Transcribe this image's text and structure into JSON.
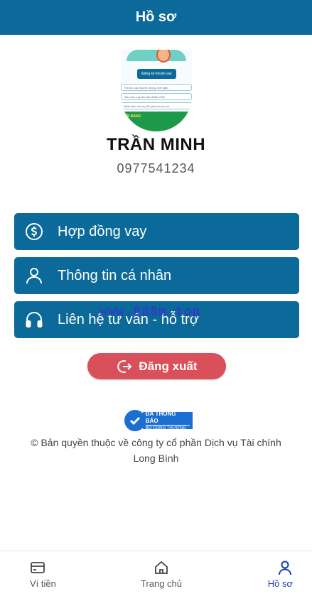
{
  "header": {
    "title": "Hồ sơ"
  },
  "avatar": {
    "mini_button": "Đăng ký khoản vay",
    "rows": [
      "Thủ tục vay nhanh chóng, đơn giản",
      "Hạn mức vay lên đến 500tr VND",
      "Nhận tiền chỉ sau 30 phút làm hồ sơ"
    ],
    "banner_tag": "IỂN BẰNG"
  },
  "profile": {
    "name": "TRẦN MINH",
    "phone": "0977541234"
  },
  "menu": {
    "items": [
      {
        "label": "Hợp đồng vay",
        "icon": "dollar-circle-icon"
      },
      {
        "label": "Thông tin cá nhân",
        "icon": "user-icon"
      },
      {
        "label": "Liên hệ tư vấn - hỗ trợ",
        "icon": "headphones-icon"
      }
    ]
  },
  "watermark": "www.888m.top",
  "logout": {
    "label": "Đăng xuất",
    "icon": "logout-icon"
  },
  "badge": {
    "line1": "ĐÃ THÔNG BÁO",
    "line2": "BỘ CÔNG THƯƠNG"
  },
  "footer": {
    "copyright": "© Bản quyền thuộc về công ty cổ phần Dịch vụ Tài chính Long Bình"
  },
  "bottom_nav": {
    "items": [
      {
        "label": "Ví tiền",
        "icon": "wallet-icon",
        "active": false
      },
      {
        "label": "Trang chủ",
        "icon": "home-icon",
        "active": false
      },
      {
        "label": "Hồ sơ",
        "icon": "user-icon",
        "active": true
      }
    ]
  },
  "colors": {
    "primary": "#0b6a99",
    "logout": "#d9505a",
    "nav_active": "#1d3fa8",
    "badge": "#1a6fd1"
  }
}
